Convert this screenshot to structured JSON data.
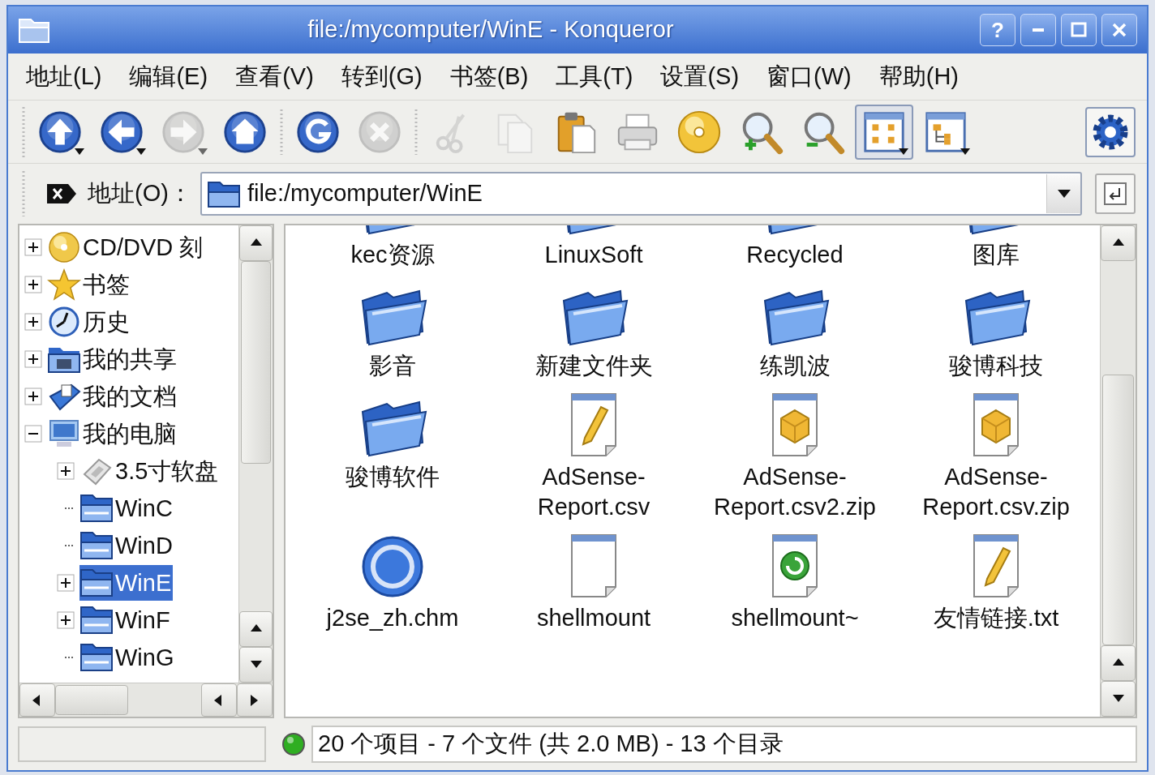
{
  "window": {
    "title": "file:/mycomputer/WinE - Konqueror"
  },
  "title_buttons": [
    {
      "kind": "help",
      "label": "?"
    },
    {
      "kind": "minimize"
    },
    {
      "kind": "maximize"
    },
    {
      "kind": "close"
    }
  ],
  "menu": [
    "地址(L)",
    "编辑(E)",
    "查看(V)",
    "转到(G)",
    "书签(B)",
    "工具(T)",
    "设置(S)",
    "窗口(W)",
    "帮助(H)"
  ],
  "toolbar": [
    {
      "kind": "up",
      "disabled": false,
      "selected": false,
      "dropdown": true
    },
    {
      "kind": "back",
      "disabled": false,
      "selected": false,
      "dropdown": true
    },
    {
      "kind": "forward",
      "disabled": true,
      "selected": false,
      "dropdown": true
    },
    {
      "kind": "home",
      "disabled": false,
      "selected": false,
      "dropdown": false
    },
    {
      "kind": "sep"
    },
    {
      "kind": "reload",
      "disabled": false,
      "selected": false,
      "dropdown": false
    },
    {
      "kind": "stop",
      "disabled": true,
      "selected": false,
      "dropdown": false
    },
    {
      "kind": "sep"
    },
    {
      "kind": "cut",
      "disabled": true,
      "selected": false,
      "dropdown": false
    },
    {
      "kind": "copy",
      "disabled": true,
      "selected": false,
      "dropdown": false
    },
    {
      "kind": "paste",
      "disabled": false,
      "selected": false,
      "dropdown": false
    },
    {
      "kind": "print",
      "disabled": false,
      "selected": false,
      "dropdown": false
    },
    {
      "kind": "disc",
      "disabled": false,
      "selected": false,
      "dropdown": false
    },
    {
      "kind": "zoom-in",
      "disabled": false,
      "selected": false,
      "dropdown": false
    },
    {
      "kind": "zoom-out",
      "disabled": false,
      "selected": false,
      "dropdown": false
    },
    {
      "kind": "icon-view",
      "disabled": false,
      "selected": true,
      "dropdown": true
    },
    {
      "kind": "tree-view",
      "disabled": false,
      "selected": false,
      "dropdown": true
    }
  ],
  "address_bar": {
    "label": "地址(O)：",
    "value": "file:/mycomputer/WinE"
  },
  "tree": [
    {
      "label": "CD/DVD 刻",
      "kind": "disc",
      "expanded": false,
      "selected": false
    },
    {
      "label": "书签",
      "kind": "star",
      "expanded": false,
      "selected": false
    },
    {
      "label": "历史",
      "kind": "clock",
      "expanded": false,
      "selected": false
    },
    {
      "label": "我的共享",
      "kind": "shared",
      "expanded": false,
      "selected": false
    },
    {
      "label": "我的文档",
      "kind": "documents",
      "expanded": false,
      "selected": false
    },
    {
      "label": "我的电脑",
      "kind": "computer",
      "expanded": true,
      "selected": false,
      "children": [
        {
          "label": "3.5寸软盘",
          "kind": "floppy",
          "expanded": false,
          "selected": false
        },
        {
          "label": "WinC",
          "kind": "folder",
          "selected": false
        },
        {
          "label": "WinD",
          "kind": "folder",
          "selected": false
        },
        {
          "label": "WinE",
          "kind": "folder",
          "expanded": false,
          "selected": true
        },
        {
          "label": "WinF",
          "kind": "folder",
          "expanded": false,
          "selected": false
        },
        {
          "label": "WinG",
          "kind": "folder",
          "selected": false
        }
      ]
    }
  ],
  "files": [
    {
      "name": "kec资源",
      "kind": "folder"
    },
    {
      "name": "LinuxSoft",
      "kind": "folder"
    },
    {
      "name": "Recycled",
      "kind": "folder"
    },
    {
      "name": "图库",
      "kind": "folder"
    },
    {
      "name": "影音",
      "kind": "folder"
    },
    {
      "name": "新建文件夹",
      "kind": "folder"
    },
    {
      "name": "练凯波",
      "kind": "folder"
    },
    {
      "name": "骏博科技",
      "kind": "folder"
    },
    {
      "name": "骏博软件",
      "kind": "folder"
    },
    {
      "name": "AdSense-Report.csv",
      "kind": "pen-document"
    },
    {
      "name": "AdSense-Report.csv2.zip",
      "kind": "package"
    },
    {
      "name": "AdSense-Report.csv.zip",
      "kind": "package"
    },
    {
      "name": "j2se_zh.chm",
      "kind": "help"
    },
    {
      "name": "shellmount",
      "kind": "blank"
    },
    {
      "name": "shellmount~",
      "kind": "script"
    },
    {
      "name": "友情链接.txt",
      "kind": "pen-document"
    }
  ],
  "status_bar": {
    "text": "20 个项目 - 7 个文件 (共 2.0 MB) - 13 个目录",
    "online": true
  }
}
